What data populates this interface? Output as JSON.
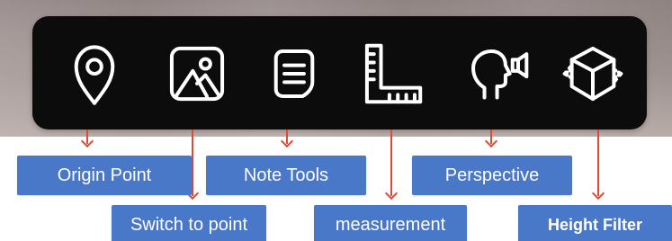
{
  "toolbar": {
    "buttons": [
      {
        "id": "origin-point",
        "icon": "map-pin-icon",
        "label": "Origin Point"
      },
      {
        "id": "switch-to-point",
        "icon": "image-icon",
        "label": "Switch to point"
      },
      {
        "id": "note-tools",
        "icon": "note-icon",
        "label": "Note Tools"
      },
      {
        "id": "measurement",
        "icon": "ruler-icon",
        "label": "measurement"
      },
      {
        "id": "perspective",
        "icon": "head-speaker-icon",
        "label": "Perspective"
      },
      {
        "id": "height-filter",
        "icon": "cube-icon",
        "label": "Height Filter"
      }
    ]
  },
  "colors": {
    "label_bg": "#4a78c8",
    "label_text": "#ffffff",
    "arrow": "#e04a35",
    "toolbar_bg": "#0c0c0c",
    "icon_stroke": "#ffffff"
  }
}
